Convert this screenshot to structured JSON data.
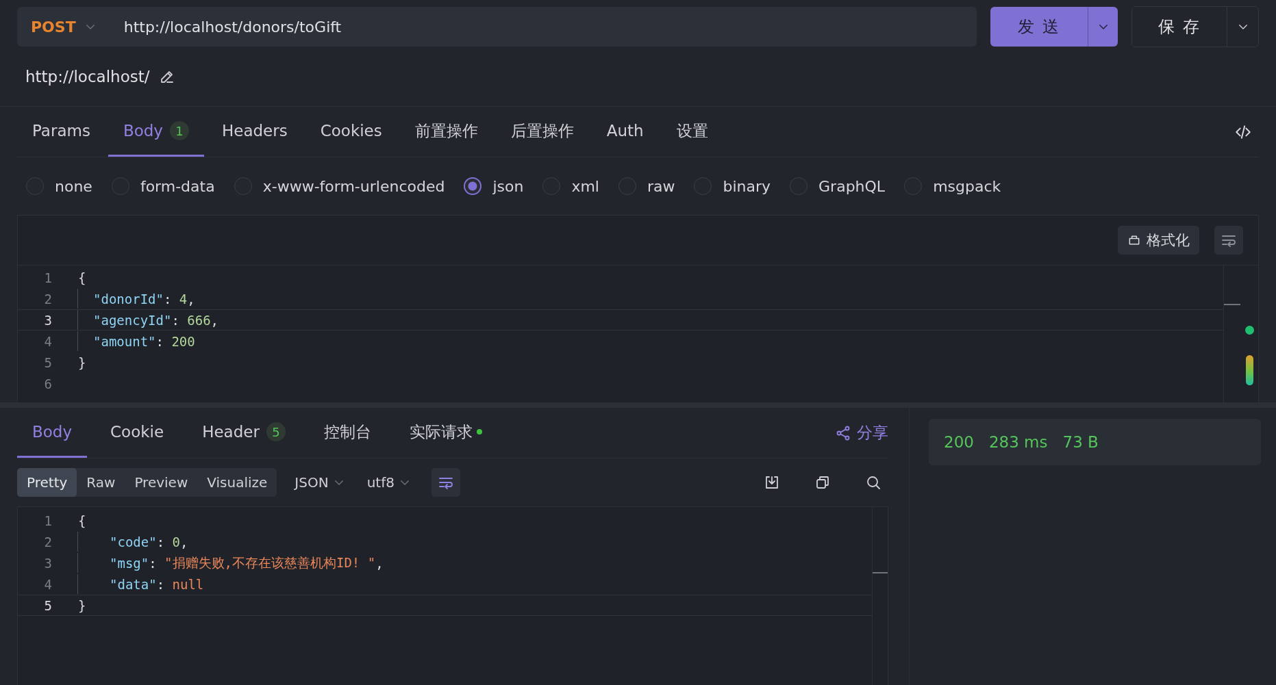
{
  "request_bar": {
    "method": "POST",
    "url": "http://localhost/donors/toGift",
    "send_label": "发 送",
    "save_label": "保 存"
  },
  "base_url": "http://localhost/",
  "request_tabs": [
    {
      "label": "Params",
      "selected": false
    },
    {
      "label": "Body",
      "selected": true,
      "badge": "1"
    },
    {
      "label": "Headers",
      "selected": false
    },
    {
      "label": "Cookies",
      "selected": false
    },
    {
      "label": "前置操作",
      "selected": false
    },
    {
      "label": "后置操作",
      "selected": false
    },
    {
      "label": "Auth",
      "selected": false
    },
    {
      "label": "设置",
      "selected": false
    }
  ],
  "body_types": [
    {
      "label": "none",
      "selected": false
    },
    {
      "label": "form-data",
      "selected": false
    },
    {
      "label": "x-www-form-urlencoded",
      "selected": false
    },
    {
      "label": "json",
      "selected": true
    },
    {
      "label": "xml",
      "selected": false
    },
    {
      "label": "raw",
      "selected": false
    },
    {
      "label": "binary",
      "selected": false
    },
    {
      "label": "GraphQL",
      "selected": false
    },
    {
      "label": "msgpack",
      "selected": false
    }
  ],
  "request_editor": {
    "format_label": "格式化",
    "wrap_on": false,
    "lines": [
      {
        "number": "1",
        "current": false,
        "indented": false,
        "tokens": [
          {
            "kind": "punct",
            "text": "{"
          }
        ]
      },
      {
        "number": "2",
        "current": false,
        "indented": true,
        "tokens": [
          {
            "kind": "key",
            "text": "\"donorId\""
          },
          {
            "kind": "punct",
            "text": ": "
          },
          {
            "kind": "number",
            "text": "4"
          },
          {
            "kind": "punct",
            "text": ","
          }
        ]
      },
      {
        "number": "3",
        "current": true,
        "indented": true,
        "tokens": [
          {
            "kind": "key",
            "text": "\"agencyId\""
          },
          {
            "kind": "punct",
            "text": ": "
          },
          {
            "kind": "number",
            "text": "666"
          },
          {
            "kind": "punct",
            "text": ","
          }
        ]
      },
      {
        "number": "4",
        "current": false,
        "indented": true,
        "tokens": [
          {
            "kind": "key",
            "text": "\"amount\""
          },
          {
            "kind": "punct",
            "text": ": "
          },
          {
            "kind": "number",
            "text": "200"
          }
        ]
      },
      {
        "number": "5",
        "current": false,
        "indented": false,
        "tokens": [
          {
            "kind": "punct",
            "text": "}"
          }
        ]
      },
      {
        "number": "6",
        "current": false,
        "indented": false
      }
    ]
  },
  "response_tabs": [
    {
      "label": "Body",
      "selected": true
    },
    {
      "label": "Cookie",
      "selected": false
    },
    {
      "label": "Header",
      "selected": false,
      "badge": "5"
    },
    {
      "label": "控制台",
      "selected": false
    },
    {
      "label": "实际请求",
      "selected": false,
      "indicator": true
    }
  ],
  "share_label": "分享",
  "view_modes": [
    {
      "label": "Pretty",
      "selected": true
    },
    {
      "label": "Raw",
      "selected": false
    },
    {
      "label": "Preview",
      "selected": false
    },
    {
      "label": "Visualize",
      "selected": false
    }
  ],
  "format_dropdown": "JSON",
  "encoding_dropdown": "utf8",
  "response_wrap_on": true,
  "response_editor": {
    "lines": [
      {
        "number": "1",
        "current": false,
        "indented": false,
        "tokens": [
          {
            "kind": "punct",
            "text": "{"
          }
        ]
      },
      {
        "number": "2",
        "current": false,
        "indented": true,
        "tokens": [
          {
            "kind": "key",
            "text": "\"code\""
          },
          {
            "kind": "punct",
            "text": ": "
          },
          {
            "kind": "number",
            "text": "0"
          },
          {
            "kind": "punct",
            "text": ","
          }
        ]
      },
      {
        "number": "3",
        "current": false,
        "indented": true,
        "tokens": [
          {
            "kind": "key",
            "text": "\"msg\""
          },
          {
            "kind": "punct",
            "text": ": "
          },
          {
            "kind": "string",
            "text": "\"捐赠失败,不存在该慈善机构ID! \""
          },
          {
            "kind": "punct",
            "text": ","
          }
        ]
      },
      {
        "number": "4",
        "current": false,
        "indented": true,
        "tokens": [
          {
            "kind": "key",
            "text": "\"data\""
          },
          {
            "kind": "punct",
            "text": ": "
          },
          {
            "kind": "null",
            "text": "null"
          }
        ]
      },
      {
        "number": "5",
        "current": true,
        "indented": false,
        "tokens": [
          {
            "kind": "punct",
            "text": "}"
          }
        ]
      }
    ]
  },
  "status": {
    "code": "200",
    "time": "283 ms",
    "size": "73 B"
  }
}
